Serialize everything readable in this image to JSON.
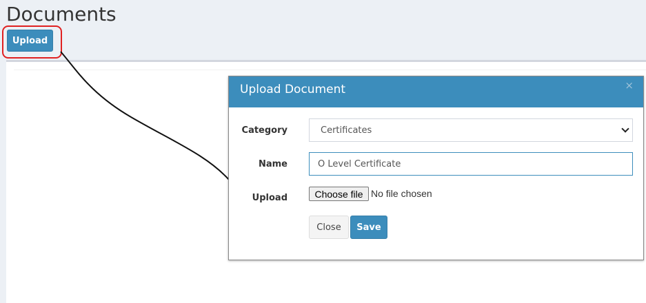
{
  "page": {
    "title": "Documents",
    "upload_button_label": "Upload"
  },
  "modal": {
    "title": "Upload Document",
    "close_icon": "×",
    "fields": {
      "category_label": "Category",
      "category_value": "Certificates",
      "name_label": "Name",
      "name_value": "O Level Certificate",
      "upload_label": "Upload",
      "file_button_label": "Choose file",
      "file_status": "No file chosen"
    },
    "buttons": {
      "close_label": "Close",
      "save_label": "Save"
    }
  },
  "colors": {
    "primary": "#3c8dbc",
    "highlight": "#e02020",
    "background": "#ecf0f5"
  },
  "icons": {
    "close": "close-icon",
    "dropdown": "chevron-down-icon"
  }
}
